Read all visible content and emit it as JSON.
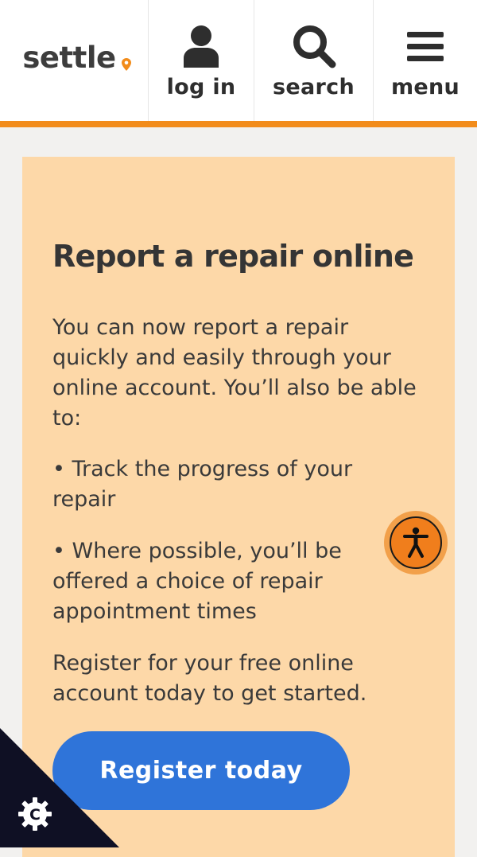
{
  "header": {
    "logo_text": "settle",
    "nav": [
      {
        "label": "log in",
        "icon": "user-icon"
      },
      {
        "label": "search",
        "icon": "search-icon"
      },
      {
        "label": "menu",
        "icon": "hamburger-menu-icon"
      }
    ],
    "accent_color": "#f28c1b"
  },
  "card": {
    "title": "Report a repair online",
    "paragraphs": [
      "You can now report a repair quickly and easily through your online account. You’ll also be able to:",
      "• Track the progress of your repair",
      "• Where possible, you’ll be offered a choice of repair appointment times",
      "Register for your free online account today to get started."
    ],
    "button_label": "Register today",
    "background_color": "#fdd8a8",
    "button_color": "#2f74d9"
  },
  "widgets": {
    "accessibility_icon": "accessibility-icon",
    "cookie_icon": "cookie-settings-icon"
  }
}
